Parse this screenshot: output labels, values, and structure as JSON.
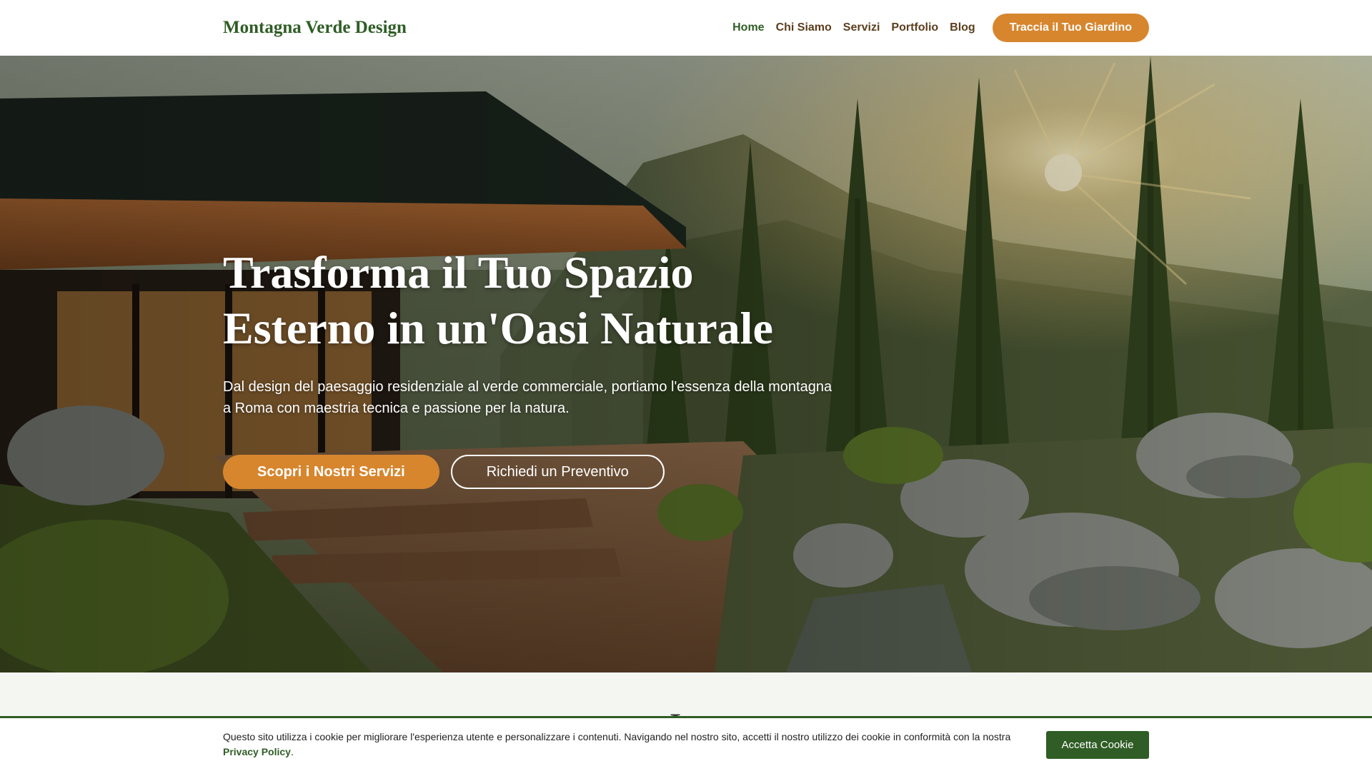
{
  "header": {
    "logo": "Montagna Verde Design",
    "nav": [
      "Home",
      "Chi Siamo",
      "Servizi",
      "Portfolio",
      "Blog"
    ],
    "cta": "Traccia il Tuo Giardino"
  },
  "hero": {
    "title_line1": "Trasforma il Tuo Spazio",
    "title_line2": "Esterno in un'Oasi Naturale",
    "subtitle": "Dal design del paesaggio residenziale al verde commerciale, portiamo l'essenza della montagna a Roma con maestria tecnica e passione per la natura.",
    "primary_button": "Scopri i Nostri Servizi",
    "secondary_button": "Richiedi un Preventivo"
  },
  "section": {
    "heading": "I..."
  },
  "cookie": {
    "text": "Questo sito utilizza i cookie per migliorare l'esperienza utente e personalizzare i contenuti. Navigando nel nostro sito, accetti il nostro utilizzo dei cookie in conformità con la nostra",
    "link": "Privacy Policy",
    "period": ".",
    "button": "Accetta Cookie"
  },
  "colors": {
    "brand_green": "#2f5d25",
    "accent_orange": "#d7862e",
    "nav_brown": "#5b3e1c"
  }
}
